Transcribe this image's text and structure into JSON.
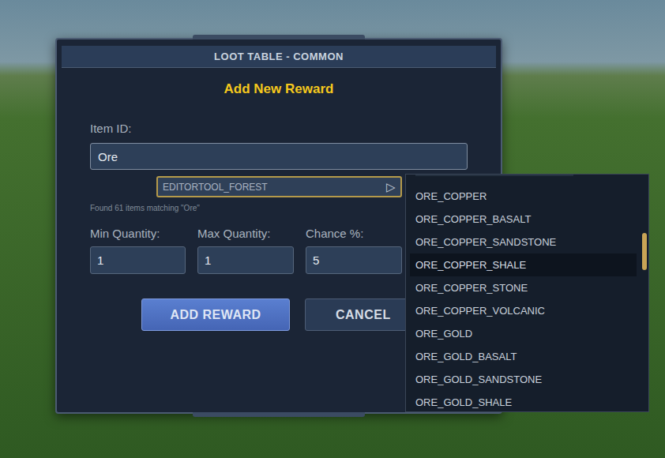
{
  "dialog": {
    "title": "LOOT TABLE - COMMON",
    "heading": "Add New Reward"
  },
  "item_id": {
    "label": "Item ID:",
    "value": "Ore"
  },
  "suggestion": {
    "text": "EDITORTOOL_FOREST",
    "icon": "▷"
  },
  "match_count": "Found 61 items matching \"Ore\"",
  "fields": [
    {
      "label": "Min Quantity:",
      "value": "1"
    },
    {
      "label": "Max Quantity:",
      "value": "1"
    },
    {
      "label": "Chance %:",
      "value": "5"
    }
  ],
  "buttons": [
    {
      "label": "ADD REWARD",
      "kind": "primary"
    },
    {
      "label": "CANCEL",
      "kind": "secondary"
    }
  ],
  "dropdown": {
    "items": [
      {
        "label": "ORE_COPPER",
        "selected": false
      },
      {
        "label": "ORE_COPPER_BASALT",
        "selected": false
      },
      {
        "label": "ORE_COPPER_SANDSTONE",
        "selected": false
      },
      {
        "label": "ORE_COPPER_SHALE",
        "selected": true
      },
      {
        "label": "ORE_COPPER_STONE",
        "selected": false
      },
      {
        "label": "ORE_COPPER_VOLCANIC",
        "selected": false
      },
      {
        "label": "ORE_GOLD",
        "selected": false
      },
      {
        "label": "ORE_GOLD_BASALT",
        "selected": false
      },
      {
        "label": "ORE_GOLD_SANDSTONE",
        "selected": false
      },
      {
        "label": "ORE_GOLD_SHALE",
        "selected": false
      }
    ],
    "scrollbar": {
      "level": 0.29
    }
  }
}
